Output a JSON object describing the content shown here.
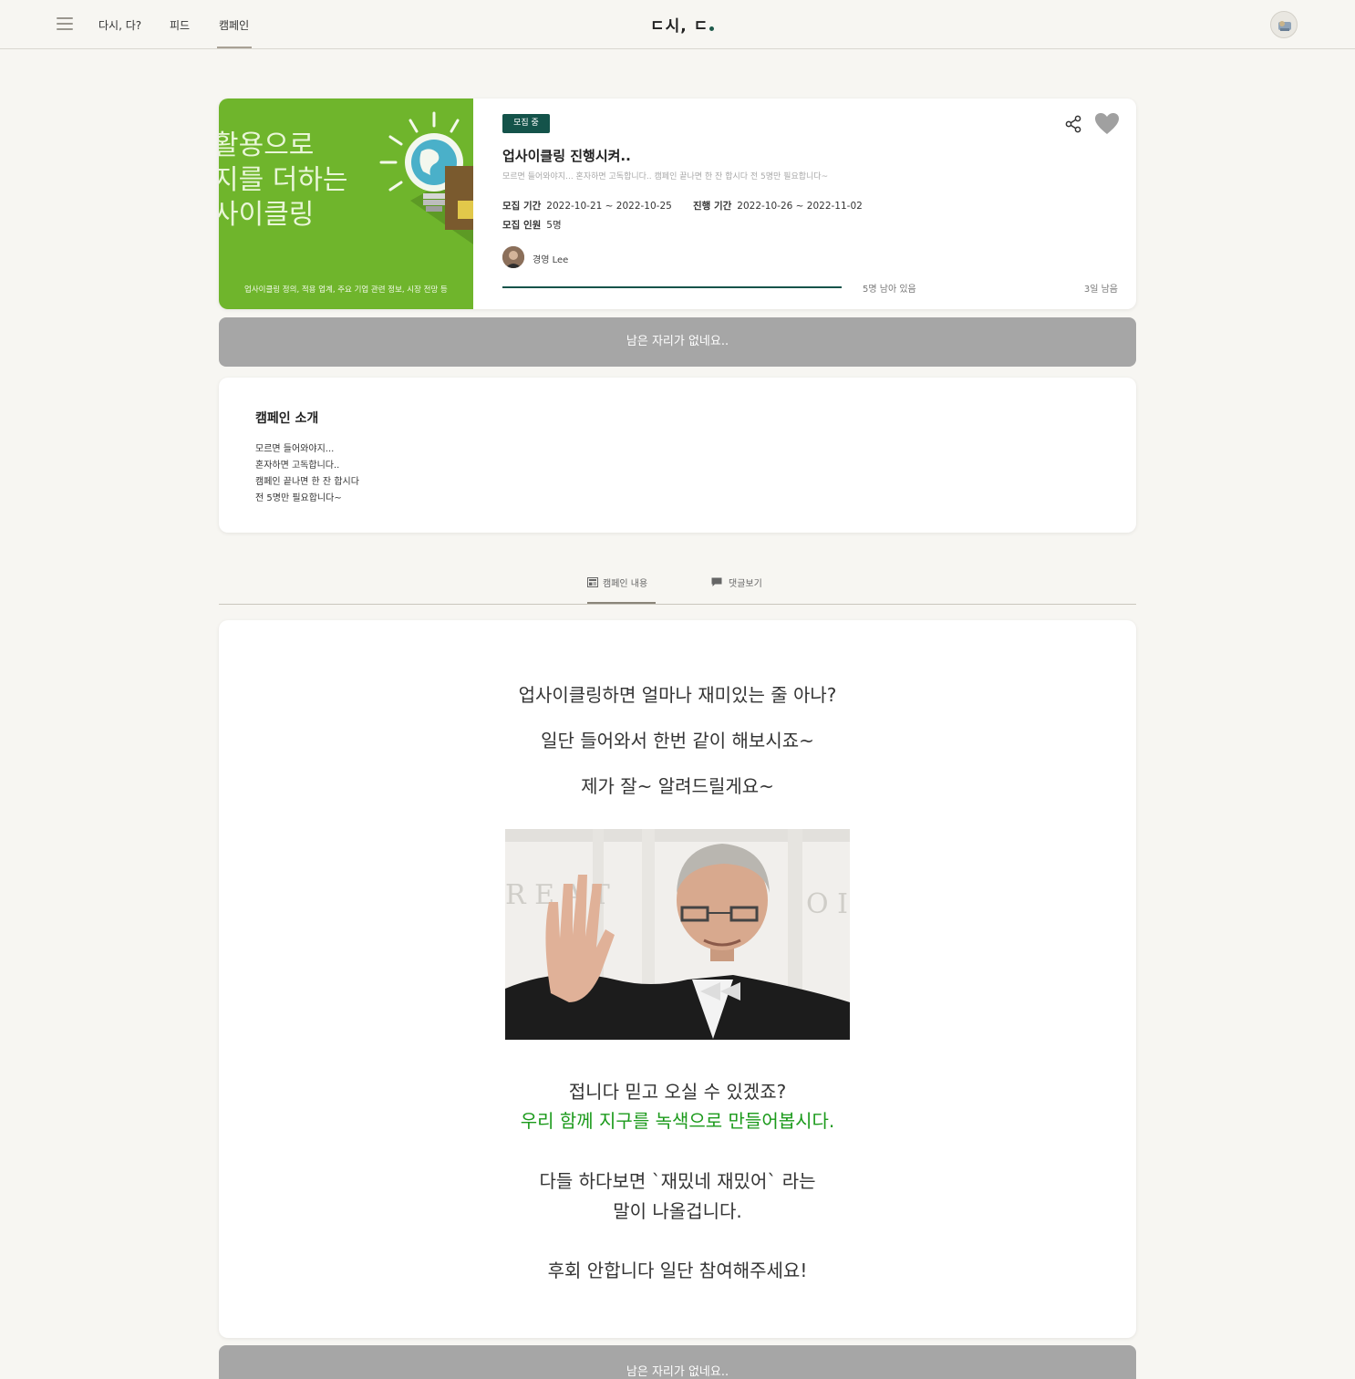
{
  "nav": {
    "links": [
      "다시, 다?",
      "피드",
      "캠페인"
    ],
    "logo": "ㄷ시, ㄷ"
  },
  "campaign": {
    "thumbnail_lines": [
      "활용으로",
      "지를 더하는",
      "사이클링"
    ],
    "thumbnail_caption": "업사이클링 정의, 적용 업계, 주요 기업 관련 정보, 시장 전망 등",
    "status_badge": "모집 중",
    "title": "업사이클링 진행시켜..",
    "description": "모르면 들어와야지... 혼자하면 고독합니다.. 캠페인 끝나면 한 잔 합시다 전 5명만 필요합니다~",
    "recruit_period_label": "모집 기간",
    "recruit_period": "2022-10-21 ~ 2022-10-25",
    "progress_period_label": "진행 기간",
    "progress_period": "2022-10-26 ~ 2022-11-02",
    "recruit_count_label": "모집 인원",
    "recruit_count": "5명",
    "author": "경영 Lee",
    "remaining_people": "5명 남아 있음",
    "remaining_days": "3일 남음",
    "progress_fraction": 1.0,
    "accent_color": "#14534a"
  },
  "full_button_label": "남은 자리가 없네요..",
  "intro": {
    "heading": "캠페인 소개",
    "lines": [
      "모르면 들어와야지...",
      "혼자하면 고독합니다..",
      "캠페인 끝나면 한 잔 합시다",
      "전 5명만 필요합니다~"
    ]
  },
  "tabs": [
    {
      "label": "캠페인 내용",
      "icon": "article-icon"
    },
    {
      "label": "댓글보기",
      "icon": "comment-icon"
    }
  ],
  "content": {
    "lines_top": [
      "업사이클링하면 얼마나 재미있는 줄 아나?",
      "일단 들어와서 한번 같이 해보시죠~",
      "제가 잘~ 알려드릴게요~"
    ],
    "line_trust": "접니다 믿고 오실 수 있겠죠?",
    "line_green": "우리 함께 지구를 녹색으로 만들어봅시다.",
    "line_fun_1": "다들 하다보면 `재밌네 재밌어` 라는",
    "line_fun_2": "말이 나올겁니다.",
    "line_last": "후회 안합니다 일단 참여해주세요!",
    "green_color": "#1b9a1b"
  }
}
